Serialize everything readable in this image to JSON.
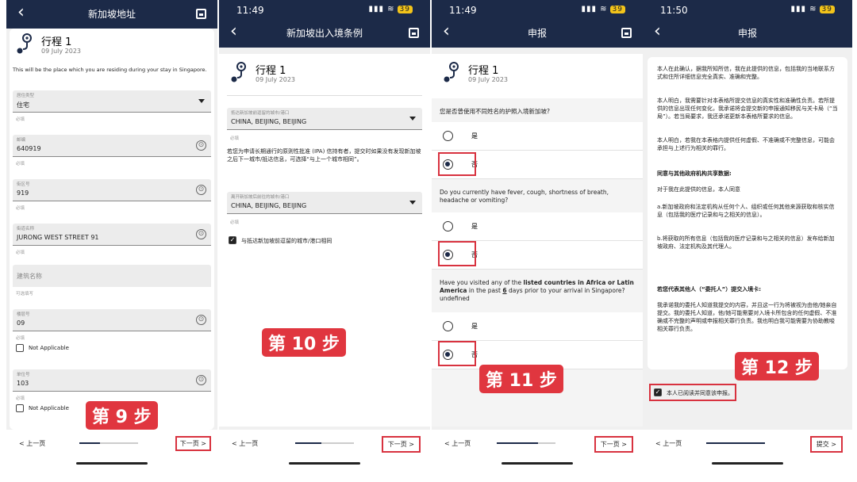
{
  "trip": {
    "name": "行程 1",
    "date": "09 July 2023"
  },
  "p1": {
    "title": "新加坡地址",
    "intro": "This will be the place which you are residing during your stay in Singapore.",
    "fields": [
      {
        "label": "居住类型",
        "value": "住宅",
        "hint": "必填"
      },
      {
        "label": "邮编",
        "value": "640919",
        "hint": "必填"
      },
      {
        "label": "街区号",
        "value": "919",
        "hint": "必填"
      },
      {
        "label": "街道名称",
        "value": "JURONG WEST STREET 91",
        "hint": "必填"
      },
      {
        "label": "",
        "value": "建筑名称",
        "hint": "可选填写"
      },
      {
        "label": "楼层号",
        "value": "09",
        "hint": "必填"
      },
      {
        "label": "单位号",
        "value": "103",
        "hint": "必填"
      }
    ],
    "na1": "Not Applicable",
    "na2": "Not Applicable",
    "prev": "< 上一页",
    "next": "下一页 >",
    "step": "第 9 步"
  },
  "p2": {
    "time": "11:49",
    "title": "新加坡出入境条例",
    "f1label": "抵达新加坡前逗留的城市/港口",
    "f1value": "CHINA, BEIJING, BEIJING",
    "hint": "必填",
    "info": "若您为申请长期通行的原则性批准 (IPA) 信持有者，提交时如果没有发现新加坡之后下一城市/抵达信息，可选择“与上一个城市相同”。",
    "f2label": "离开新加坡后前往的城市/港口",
    "f2value": "CHINA, BEIJING, BEIJING",
    "hint2": "必填",
    "same": "与抵达新加坡前逗留的城市/港口相同",
    "prev": "< 上一页",
    "next": "下一页 >",
    "step": "第 10 步"
  },
  "p3": {
    "time": "11:49",
    "title": "申报",
    "q1": "您是否曾使用不同姓名的护照入境新加坡?",
    "q2": "Do you currently have fever, cough, shortness of breath, headache or vomiting?",
    "q3a": "Have you visited any of the ",
    "q3b": "listed countries in Africa or Latin America",
    "q3c": " in the past ",
    "q3d": "6",
    "q3e": " days prior to your arrival in Singapore? undefined",
    "yes": "是",
    "no": "否",
    "prev": "< 上一页",
    "next": "下一页 >",
    "step": "第 11 步"
  },
  "p4": {
    "time": "11:50",
    "title": "申报",
    "para1": "本人在此确认，据我所知所信，我在此提供的信息，包括我的当地联系方式和住所详细信息完全真实、准确和完整。",
    "para2": "本人明白，我需要针对本表格所提交信息的真实性和准确性负责。若所提供的信息出现任何变化，我承诺将会提交新的申报通知移民与关卡局（“当局”）。若当局要求，我还承诺更新本表格所要求的信息。",
    "para3": "本人明白，若我在本表格内提供任何虚假、不准确或不完整信息，可能会承担与上述行为相关的罪行。",
    "head1": "同意与其他政府机构共享数据:",
    "para4": "对于我在此提供的信息，本人同意",
    "para5": "a.新加坡政府和法定机构从任何个人、组织或任何其他来源获取和核实信息（包括我的医疗记录和与之相关的信息）。",
    "para6": "b.将获取的所有信息（包括我的医疗记录和与之相关的信息）发布给新加坡政府、法定机构及其代理人。",
    "head2": "若您代表其他人（“委托人”）提交入境卡:",
    "para7": "我承诺我的委托人知道我提交的内容，并且这一行为将被视为由他/她亲自提交。我的委托人知道，他/她可能需要对入境卡所包含的任何虚假、不准确或不完整的声明或申报相关罪行负责。我也明白我可能需要为协助教唆相关罪行负责。",
    "agree": "本人已阅读并同意该申报。",
    "prev": "< 上一页",
    "next": "提交 >",
    "step": "第 12 步"
  },
  "status": {
    "icons": "▮▮▮ ≋",
    "batt": "39"
  },
  "colors": {
    "nav": "#1c2a48",
    "highlight": "#d8323f",
    "step_badge": "#e0363f"
  }
}
